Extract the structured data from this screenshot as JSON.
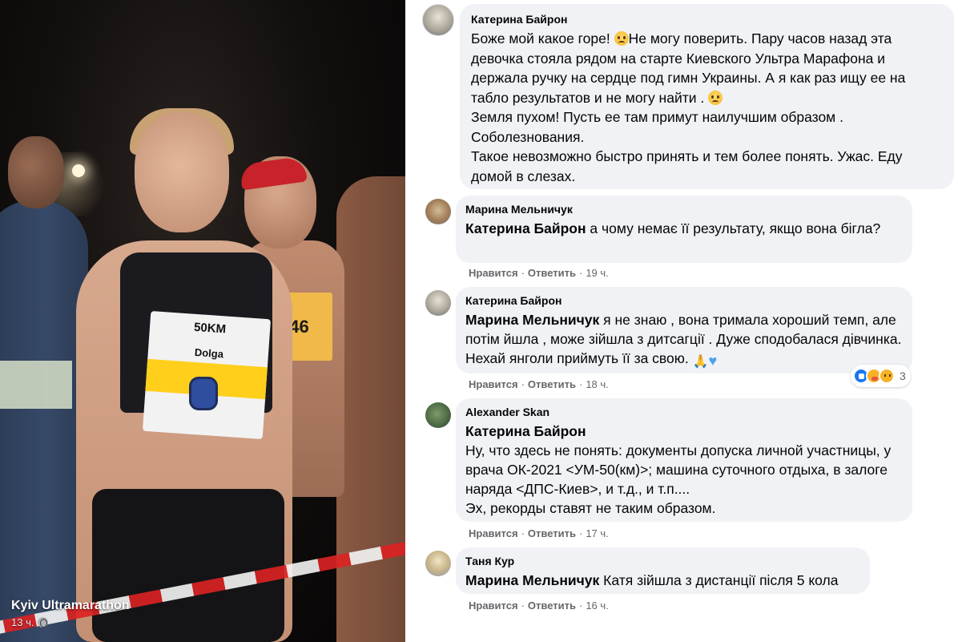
{
  "photo": {
    "caption": "Kyiv Ultramarathon",
    "time": "13 ч.",
    "bib_left": "50KM",
    "bib_name": "Dolga",
    "bib_right": "546"
  },
  "comments": [
    {
      "author": "Катерина Байрон",
      "text_parts": [
        "Боже мой какое горе! ",
        "Не могу поверить. Пару часов назад эта девочка стояла рядом на старте Киевского Ультра Марафона и держала ручку на сердце под гимн Украины. А я как раз ищу ее на табло результатов и не могу найти . ",
        "Земля пухом! Пусть ее там примут наилучшим образом .",
        "Соболезнования.",
        "Такое невозможно быстро принять и тем более понять. Ужас. Еду домой в слезах."
      ]
    },
    {
      "author": "Марина Мельничук",
      "mention": "Катерина Байрон",
      "text": " а чому немає її результату, якщо вона бігла?",
      "like": "Нравится",
      "reply": "Ответить",
      "time": "19 ч."
    },
    {
      "author": "Катерина Байрон",
      "mention": "Марина Мельничук",
      "text": " я не знаю , вона тримала хороший темп, але потім йшла , може зійшла з дитсагції . Дуже сподобалася дівчинка. Нехай янголи приймуть її за свою. ",
      "like": "Нравится",
      "reply": "Ответить",
      "time": "18 ч.",
      "reaction_count": "3"
    },
    {
      "author": "Alexander Skan",
      "mention": "Катерина Байрон",
      "text": "Ну, что здесь не понять: документы допуска личной участницы, у врача ОК-2021 <УМ-50(км)>; машина суточного отдыха, в залоге наряда <ДПС-Киев>, и т.д., и т.п....",
      "text2": "Эх, рекорды ставят не таким образом.",
      "like": "Нравится",
      "reply": "Ответить",
      "time": "17 ч."
    },
    {
      "author": "Таня Кур",
      "mention": "Марина Мельничук",
      "text": " Катя зійшла з дистанції після 5 кола",
      "like": "Нравится",
      "reply": "Ответить",
      "time": "16 ч."
    }
  ],
  "separator": "·",
  "icons": {
    "globe": "globe-icon",
    "sad_emoji": "sad-face-emoji-icon",
    "pray_emoji": "folded-hands-emoji-icon",
    "heart_emoji": "blue-heart-emoji-icon",
    "reactions": [
      "like-reaction-icon",
      "care-reaction-icon",
      "sad-reaction-icon"
    ]
  },
  "colors": {
    "bubble": "#f0f2f5",
    "meta_text": "#65676b",
    "like_blue": "#1877f2"
  }
}
